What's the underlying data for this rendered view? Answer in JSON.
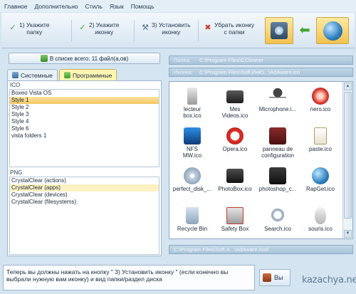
{
  "menu": [
    "Главное",
    "Дополнительно",
    "Стиль",
    "Язык",
    "Помощь"
  ],
  "toolbar": {
    "step1": "1) Укажите\nпапку",
    "step2": "2) Укажите\nиконку",
    "step3": "3) Установить\nиконку",
    "remove": "Убрать иконку\nс папки"
  },
  "left": {
    "count_button": "В списке всего: 11 файл(а,ов)",
    "tabs": [
      {
        "label": "Системные"
      },
      {
        "label": "Программные"
      }
    ],
    "ico_label": "ICO",
    "ico_items": [
      "Boxeo Vista OS",
      "Style 1",
      "Style 2",
      "Style 3",
      "Style 4",
      "Style 6",
      "vista folders 1"
    ],
    "png_label": "PNG",
    "png_items": [
      "CrystalClear (actions)",
      "CrystalClear (apps)",
      "CrystalClear (devices)",
      "CrystalClear (filesystems)"
    ]
  },
  "right": {
    "folder_label": "Папка:",
    "folder_path": "C:\\Program Files\\CCleaner",
    "icon_label": "Иконка:",
    "icon_path": "C:\\Program Files\\Soft.ИнЮ...\\AdAware.ico",
    "icons": [
      {
        "name": "lecteur\nbox.ico",
        "icon": "usb-device-icon"
      },
      {
        "name": "Mes\nVideos.ico",
        "icon": "video-camera-icon"
      },
      {
        "name": "Microphone.i...",
        "icon": "microphone-icon"
      },
      {
        "name": "nero.ico",
        "icon": "nero-icon"
      },
      {
        "name": "NFS\nMW.ico",
        "icon": "nfs-icon"
      },
      {
        "name": "Opera.ico",
        "icon": "opera-icon"
      },
      {
        "name": "panneau de\nconfiguration",
        "icon": "control-panel-icon"
      },
      {
        "name": "paste.ico",
        "icon": "clipboard-icon"
      },
      {
        "name": "perfect_disk_...",
        "icon": "disk-icon"
      },
      {
        "name": "PhotoBox.ico",
        "icon": "photobox-icon"
      },
      {
        "name": "photoshop_c...",
        "icon": "photoshop-icon"
      },
      {
        "name": "RapGet.ico",
        "icon": "rapget-icon"
      },
      {
        "name": "Recycle Bin",
        "icon": "recycle-bin-icon"
      },
      {
        "name": "Safety Box",
        "icon": "safety-box-icon"
      },
      {
        "name": "Search.ico",
        "icon": "search-icon"
      },
      {
        "name": "souris.ico",
        "icon": "mouse-icon"
      }
    ],
    "bottom_path": "C:\\Program Files\\Soft.A...\\AdAware.ico0"
  },
  "status": {
    "text": "Теперь вы должны нажать на кнопку \" 3) Установить иконку \" (если конечно вы выбрали нужную вам иконку) и вид папки/раздел диска",
    "button_label": "Вы"
  },
  "watermark": "kazachya.net"
}
